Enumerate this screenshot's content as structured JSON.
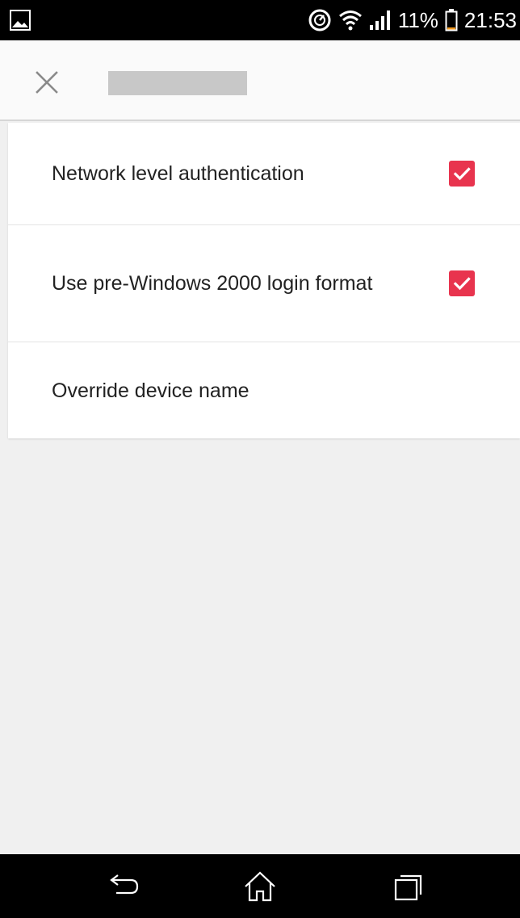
{
  "status_bar": {
    "battery_percent": "11%",
    "time": "21:53",
    "icons": [
      "gallery-icon",
      "data-saver-icon",
      "wifi-icon",
      "signal-icon",
      "battery-icon"
    ]
  },
  "app_bar": {
    "close_icon": "close-icon",
    "title": ""
  },
  "settings": {
    "items": [
      {
        "label": "Network level authentication",
        "checked": true
      },
      {
        "label": "Use pre-Windows 2000 login format",
        "checked": true
      },
      {
        "label": "Override device name"
      }
    ]
  },
  "nav_bar": {
    "icons": [
      "back-icon",
      "home-icon",
      "recents-icon"
    ]
  },
  "colors": {
    "accent": "#e8344e",
    "status_bar_bg": "#000000",
    "app_bar_bg": "#fafafa",
    "background": "#f0f0f0",
    "title_placeholder": "#c8c8c8"
  }
}
